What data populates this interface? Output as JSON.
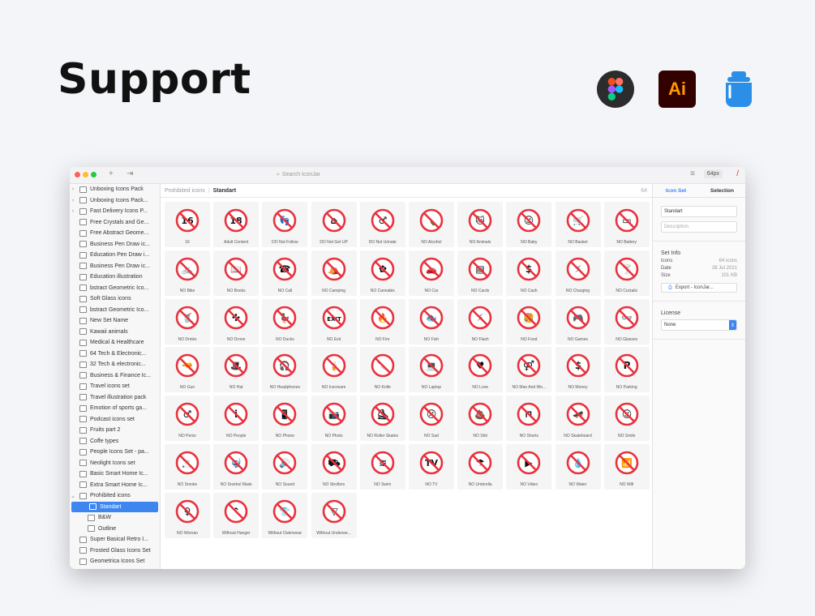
{
  "headline": "Support",
  "apps": {
    "ai_label": "Ai"
  },
  "window": {
    "search_placeholder": "Search IconJar",
    "icon_size": "64px"
  },
  "sidebar": {
    "sets": [
      {
        "label": "Unboxing Icons Pack",
        "kind": "folder"
      },
      {
        "label": "Unboxing Icons Pack...",
        "kind": "folder"
      },
      {
        "label": "Fast Delivery Icons P...",
        "kind": "folder"
      },
      {
        "label": "Free Crystals and Ge...",
        "kind": "set"
      },
      {
        "label": "Free Abstract Geome...",
        "kind": "set"
      },
      {
        "label": "Business Pen Draw ic...",
        "kind": "set"
      },
      {
        "label": "Education Pen Draw i...",
        "kind": "set"
      },
      {
        "label": "Business Pen Draw ic...",
        "kind": "set"
      },
      {
        "label": "Education illustration",
        "kind": "set"
      },
      {
        "label": "bstract Geometric Ico...",
        "kind": "set"
      },
      {
        "label": "Soft Glass icons",
        "kind": "set"
      },
      {
        "label": "bstract Geometric Ico...",
        "kind": "set"
      },
      {
        "label": "New Set Name",
        "kind": "set"
      },
      {
        "label": "Kawaii animals",
        "kind": "set"
      },
      {
        "label": "Medical & Healthcare",
        "kind": "set"
      },
      {
        "label": "64 Tech & Electronic...",
        "kind": "set"
      },
      {
        "label": "32 Tech & electronic...",
        "kind": "set"
      },
      {
        "label": "Business & Finance Ic...",
        "kind": "set"
      },
      {
        "label": "Travel icons set",
        "kind": "set"
      },
      {
        "label": "Travel illustration pack",
        "kind": "set"
      },
      {
        "label": "Emotion of sports ga...",
        "kind": "set"
      },
      {
        "label": "Podcast icons set",
        "kind": "set"
      },
      {
        "label": "Fruits part 2",
        "kind": "set"
      },
      {
        "label": "Coffe types",
        "kind": "set"
      },
      {
        "label": "People Icons Set - pa...",
        "kind": "set"
      },
      {
        "label": "Neolight Icons set",
        "kind": "set"
      },
      {
        "label": "Basic Smart Home Ic...",
        "kind": "set"
      },
      {
        "label": "Extra Smart Home Ic...",
        "kind": "set"
      },
      {
        "label": "Prohibited icons",
        "kind": "folder-open"
      },
      {
        "label": "Standart",
        "kind": "child",
        "selected": true
      },
      {
        "label": "B&W",
        "kind": "child"
      },
      {
        "label": "Outline",
        "kind": "child"
      },
      {
        "label": "Super Basical Retro I...",
        "kind": "set"
      },
      {
        "label": "Frosted Glass Icons Set",
        "kind": "set"
      },
      {
        "label": "Geometrica Icons Set",
        "kind": "set"
      }
    ]
  },
  "breadcrumb": {
    "parent": "Prohibited icons",
    "current": "Standart",
    "count": "64"
  },
  "icons": [
    {
      "label": "16",
      "glyph": "16"
    },
    {
      "label": "Adult Content",
      "glyph": "18"
    },
    {
      "label": "DO Not Follow",
      "glyph": "👣"
    },
    {
      "label": "DO Not Get UP",
      "glyph": "⌂"
    },
    {
      "label": "DO Not Urinate",
      "glyph": "♂"
    },
    {
      "label": "NO Alcohol",
      "glyph": "🍾"
    },
    {
      "label": "NO Animals",
      "glyph": "🐱"
    },
    {
      "label": "NO Baby",
      "glyph": "☺"
    },
    {
      "label": "NO Basket",
      "glyph": "🛒"
    },
    {
      "label": "NO Battery",
      "glyph": "▭"
    },
    {
      "label": "NO Bike",
      "glyph": "🚲"
    },
    {
      "label": "NO Books",
      "glyph": "📖"
    },
    {
      "label": "NO Call",
      "glyph": "☎"
    },
    {
      "label": "NO Camping",
      "glyph": "⛺"
    },
    {
      "label": "NO Cannabis",
      "glyph": "✿"
    },
    {
      "label": "NO Car",
      "glyph": "🚗"
    },
    {
      "label": "NO Cards",
      "glyph": "▤"
    },
    {
      "label": "NO Cash",
      "glyph": "$"
    },
    {
      "label": "NO Charging",
      "glyph": "⚡"
    },
    {
      "label": "NO Coctails",
      "glyph": "🍸"
    },
    {
      "label": "NO Drinks",
      "glyph": "🥤"
    },
    {
      "label": "NO Drone",
      "glyph": "✣"
    },
    {
      "label": "NO Ducks",
      "glyph": "🦆"
    },
    {
      "label": "NO Exit",
      "glyph": "EXIT"
    },
    {
      "label": "NO Fire",
      "glyph": "🔥"
    },
    {
      "label": "NO Fish",
      "glyph": "🐟"
    },
    {
      "label": "NO Flash",
      "glyph": "⚡"
    },
    {
      "label": "NO Food",
      "glyph": "🍔"
    },
    {
      "label": "NO Games",
      "glyph": "🎮"
    },
    {
      "label": "NO Glasses",
      "glyph": "👓"
    },
    {
      "label": "NO Gun",
      "glyph": "🔫"
    },
    {
      "label": "NO Hat",
      "glyph": "🎩"
    },
    {
      "label": "NO Headphones",
      "glyph": "🎧"
    },
    {
      "label": "NO Icecream",
      "glyph": "🍦"
    },
    {
      "label": "NO Knife",
      "glyph": "🔪"
    },
    {
      "label": "NO Laptop",
      "glyph": "💻"
    },
    {
      "label": "NO Love",
      "glyph": "♥"
    },
    {
      "label": "NO Man And Wo...",
      "glyph": "⚤"
    },
    {
      "label": "NO Money",
      "glyph": "$"
    },
    {
      "label": "NO Parking",
      "glyph": "P"
    },
    {
      "label": "NO Penis",
      "glyph": "♂"
    },
    {
      "label": "NO People",
      "glyph": "i"
    },
    {
      "label": "NO Phone",
      "glyph": "📱"
    },
    {
      "label": "NO Photo",
      "glyph": "📷"
    },
    {
      "label": "NO Roller Skates",
      "glyph": "⛸"
    },
    {
      "label": "NO Sad",
      "glyph": "☹"
    },
    {
      "label": "NO Shit",
      "glyph": "💩"
    },
    {
      "label": "NO Shorts",
      "glyph": "⊓"
    },
    {
      "label": "NO Skateboard",
      "glyph": "🛹"
    },
    {
      "label": "NO Smile",
      "glyph": "☺"
    },
    {
      "label": "NO Smoke",
      "glyph": "🚬"
    },
    {
      "label": "NO Snorkel Mask",
      "glyph": "🤿"
    },
    {
      "label": "NO Sound",
      "glyph": "🔊"
    },
    {
      "label": "NO Strollers",
      "glyph": "⛟"
    },
    {
      "label": "NO Swim",
      "glyph": "≋"
    },
    {
      "label": "NO TV",
      "glyph": "TV"
    },
    {
      "label": "NO Umbrella",
      "glyph": "☂"
    },
    {
      "label": "NO Video",
      "glyph": "▶"
    },
    {
      "label": "NO Water",
      "glyph": "💧"
    },
    {
      "label": "NO Wifi",
      "glyph": "📶"
    },
    {
      "label": "NO Woman",
      "glyph": "♀"
    },
    {
      "label": "Without Hanger",
      "glyph": "⌃"
    },
    {
      "label": "Without Outerwear",
      "glyph": "👕"
    },
    {
      "label": "Without Underwe...",
      "glyph": "▽"
    }
  ],
  "inspector": {
    "tab_icon_set": "Icon Set",
    "tab_selection": "Selection",
    "name_value": "Standart",
    "description_placeholder": "Description",
    "set_info_title": "Set Info",
    "icons_key": "Icons",
    "icons_val": "64 icons",
    "date_key": "Date",
    "date_val": "28 Jul 2021",
    "size_key": "Size",
    "size_val": "101 KB",
    "export_label": "Export - IconJar...",
    "license_title": "License",
    "license_value": "None"
  },
  "colors": {
    "accent": "#3d86f0",
    "prohibit_red": "#e8323e",
    "selection": "#3d86f0"
  }
}
